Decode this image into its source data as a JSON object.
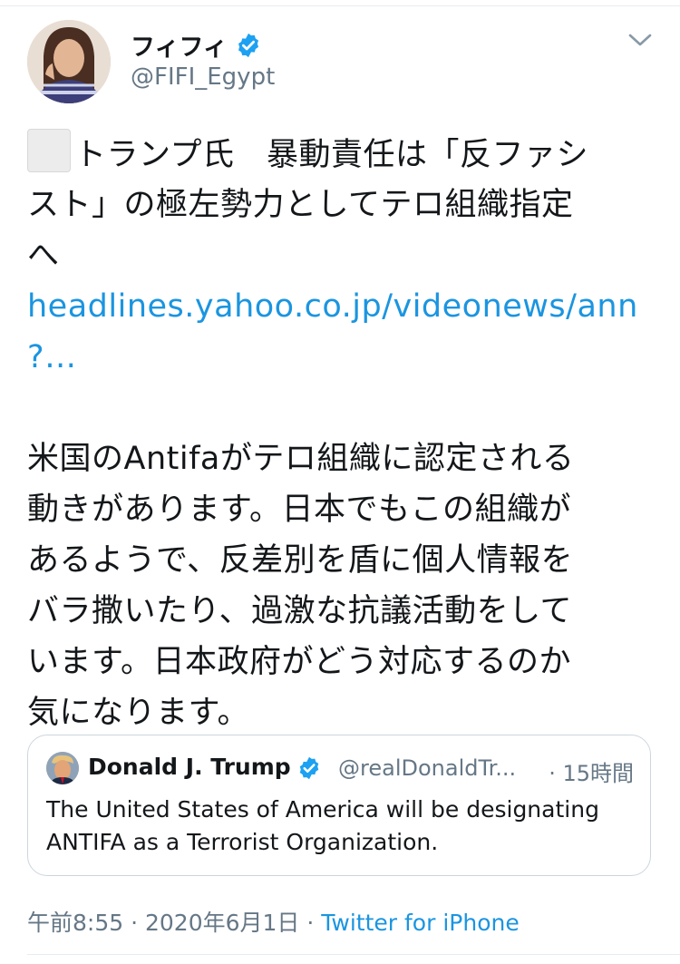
{
  "author": {
    "display_name": "フィフィ",
    "handle": "@FIFI_Egypt",
    "verified": true
  },
  "tweet": {
    "lines": [
      "トランプ氏　暴動責任は「反ファシ",
      "スト」の極左勢力としてテロ組織指定",
      "へ"
    ],
    "link_lines": [
      "headlines.yahoo.co.jp/videonews/ann",
      "?…"
    ],
    "body_lines": [
      "米国のAntifaがテロ組織に認定される",
      "動きがあります。日本でもこの組織が",
      "あるようで、反差別を盾に個人情報を",
      "バラ撒いたり、過激な抗議活動をして",
      "います。日本政府がどう対応するのか",
      "気になります。"
    ]
  },
  "quoted": {
    "name": "Donald J. Trump",
    "handle": "@realDonaldTr...",
    "time": "· 15時間",
    "text_lines": [
      "The United States of America will be designating",
      "ANTIFA as a Terrorist Organization."
    ]
  },
  "meta": {
    "timestamp": "午前8:55 · 2020年6月1日 · ",
    "source": "Twitter for iPhone"
  },
  "colors": {
    "link": "#1b95e0",
    "verified": "#1da1f2",
    "secondary_text": "#657786"
  },
  "icons": {
    "verified": "verified-badge-icon",
    "chevron": "chevron-down-icon",
    "emoji_placeholder": "missing-emoji-icon"
  }
}
